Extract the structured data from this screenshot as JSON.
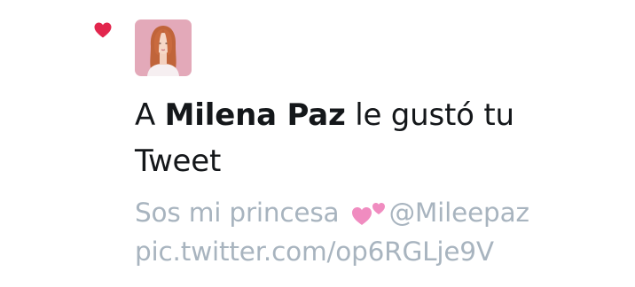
{
  "notification": {
    "action_prefix": "A ",
    "user_name": "Milena Paz",
    "action_suffix": " le gustó tu",
    "action_object": "Tweet"
  },
  "tweet": {
    "text": "Sos mi princesa",
    "emoji": "two-hearts-emoji",
    "mention": "@Mileepaz",
    "link": "pic.twitter.com/op6RGLje9V"
  },
  "icons": {
    "activity_icon": "heart-icon",
    "activity_icon_color": "#e2264d",
    "emoji_color": "#f08cc0"
  },
  "colors": {
    "primary_text": "#14171a",
    "muted_text": "#a8b4bf",
    "avatar_background": "#e3a9b9"
  }
}
